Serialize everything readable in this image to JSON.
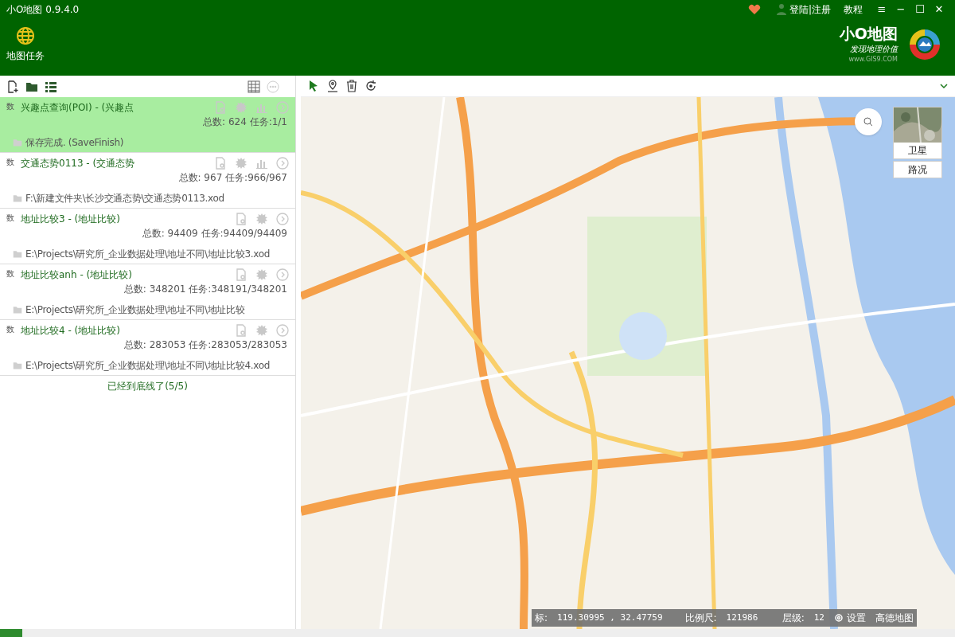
{
  "window": {
    "title": "小O地图 0.9.4.0",
    "controls": [
      "≡",
      "−",
      "☐",
      "✕"
    ]
  },
  "header": {
    "links": [
      "登陆|注册",
      "教程"
    ],
    "ribbon_button": "地图任务",
    "brand": {
      "name": "小O地图",
      "slogan": "发现地理价值",
      "url": "www.GIS9.COM"
    }
  },
  "tasks": [
    {
      "tag": "数",
      "title": "兴趣点查询(POI) - (兴趣点",
      "stats": "总数: 624 任务:1/1",
      "path": "保存完成. (SaveFinish)",
      "selected": true,
      "chart_button": true
    },
    {
      "tag": "数",
      "title": "交通态势0113 - (交通态势",
      "stats": "总数: 967 任务:966/967",
      "path": "F:\\新建文件夹\\长沙交通态势\\交通态势0113.xod",
      "selected": false,
      "chart_button": true
    },
    {
      "tag": "数",
      "title": "地址比较3 - (地址比较)",
      "stats": "总数: 94409 任务:94409/94409",
      "path": "E:\\Projects\\研究所_企业数据处理\\地址不同\\地址比较3.xod",
      "selected": false,
      "chart_button": false
    },
    {
      "tag": "数",
      "title": "地址比较anh - (地址比较)",
      "stats": "总数: 348201 任务:348191/348201",
      "path": "E:\\Projects\\研究所_企业数据处理\\地址不同\\地址比较",
      "selected": false,
      "chart_button": false
    },
    {
      "tag": "数",
      "title": "地址比较4 - (地址比较)",
      "stats": "总数: 283053 任务:283053/283053",
      "path": "E:\\Projects\\研究所_企业数据处理\\地址不同\\地址比较4.xod",
      "selected": false,
      "chart_button": false
    }
  ],
  "list_footer": "已经到底线了(5/5)",
  "map": {
    "layers": [
      {
        "label": "卫星",
        "selected": true
      },
      {
        "label": "路况",
        "selected": false
      }
    ],
    "status": {
      "coords_label": "标:",
      "coords": "119.30995 , 32.47759",
      "scale_label": "比例尺:",
      "scale": "121986",
      "zoom_label": "层级:",
      "zoom": "12",
      "settings": "设置",
      "provider": "高德地图"
    }
  }
}
